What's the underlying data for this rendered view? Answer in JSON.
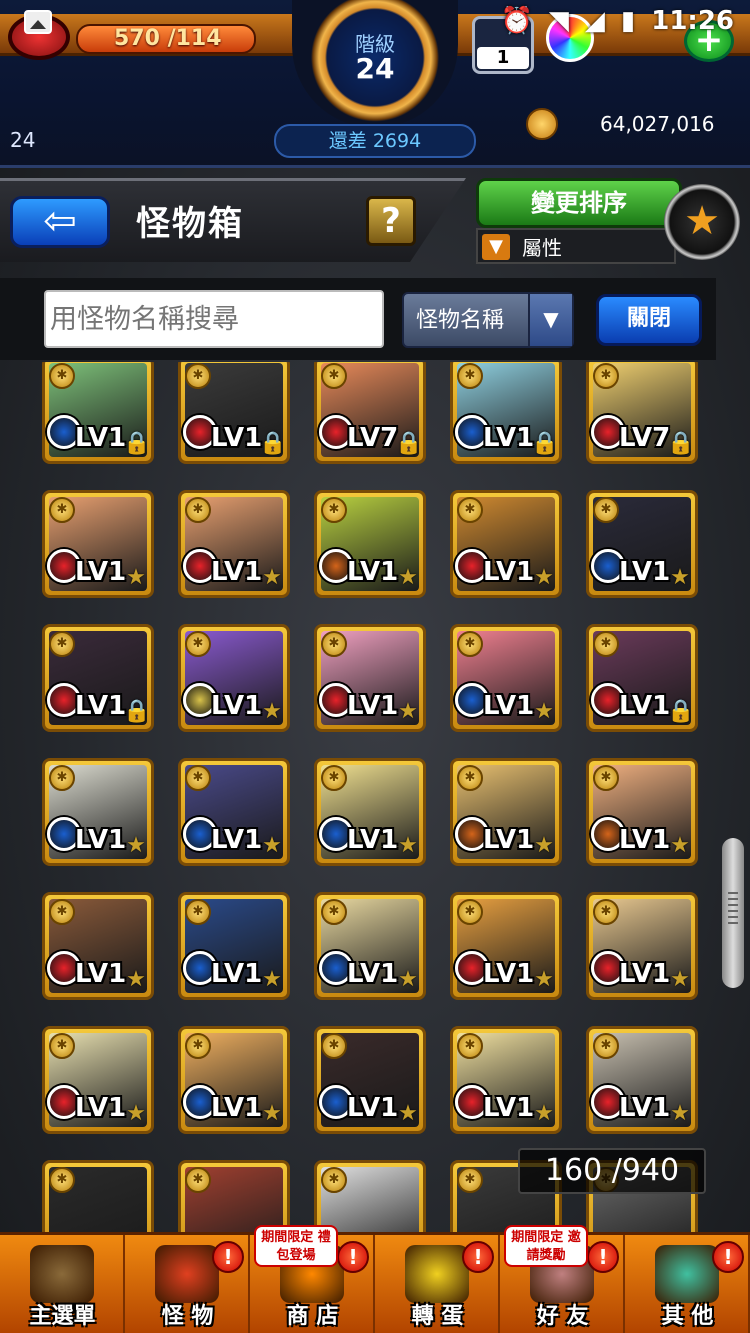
{
  "status_bar": {
    "time": "11:26"
  },
  "hud": {
    "stamina": "570 /114",
    "rank_label": "階級",
    "rank_value": "24",
    "exp_remaining": "還差 2694",
    "left_number": "24",
    "gem_count": "1",
    "coins": "64,027,016",
    "plus": "+"
  },
  "header": {
    "back_arrow": "⇦",
    "title": "怪物箱",
    "help": "?",
    "sort_button": "變更排序",
    "filter_label": "屬性",
    "filter_icon": "filter-icon",
    "star_icon": "★"
  },
  "search": {
    "placeholder": "用怪物名稱搜尋",
    "select_value": "怪物名稱",
    "select_arrow": "▼",
    "close_button": "關閉"
  },
  "grid": {
    "counter": "160 /940",
    "cards": [
      {
        "lv": "LV1",
        "attr": "water",
        "mark": "lock"
      },
      {
        "lv": "LV1",
        "attr": "fire",
        "mark": "lock"
      },
      {
        "lv": "LV7",
        "attr": "fire",
        "mark": "lock"
      },
      {
        "lv": "LV1",
        "attr": "water",
        "mark": "lock"
      },
      {
        "lv": "LV7",
        "attr": "fire",
        "mark": "lock"
      },
      {
        "lv": "LV1",
        "attr": "fire",
        "mark": "star"
      },
      {
        "lv": "LV1",
        "attr": "fire",
        "mark": "star"
      },
      {
        "lv": "LV1",
        "attr": "wood",
        "mark": "star"
      },
      {
        "lv": "LV1",
        "attr": "fire",
        "mark": "star"
      },
      {
        "lv": "LV1",
        "attr": "water",
        "mark": "star"
      },
      {
        "lv": "LV1",
        "attr": "fire",
        "mark": "lock"
      },
      {
        "lv": "LV1",
        "attr": "light",
        "mark": "star"
      },
      {
        "lv": "LV1",
        "attr": "fire",
        "mark": "star"
      },
      {
        "lv": "LV1",
        "attr": "water",
        "mark": "star"
      },
      {
        "lv": "LV1",
        "attr": "fire",
        "mark": "lock"
      },
      {
        "lv": "LV1",
        "attr": "water",
        "mark": "star"
      },
      {
        "lv": "LV1",
        "attr": "water",
        "mark": "star"
      },
      {
        "lv": "LV1",
        "attr": "water",
        "mark": "star"
      },
      {
        "lv": "LV1",
        "attr": "wood",
        "mark": "star"
      },
      {
        "lv": "LV1",
        "attr": "wood",
        "mark": "star"
      },
      {
        "lv": "LV1",
        "attr": "fire",
        "mark": "star"
      },
      {
        "lv": "LV1",
        "attr": "water",
        "mark": "star"
      },
      {
        "lv": "LV1",
        "attr": "water",
        "mark": "star"
      },
      {
        "lv": "LV1",
        "attr": "fire",
        "mark": "star"
      },
      {
        "lv": "LV1",
        "attr": "fire",
        "mark": "star"
      },
      {
        "lv": "LV1",
        "attr": "fire",
        "mark": "star"
      },
      {
        "lv": "LV1",
        "attr": "water",
        "mark": "star"
      },
      {
        "lv": "LV1",
        "attr": "water",
        "mark": "star"
      },
      {
        "lv": "LV1",
        "attr": "fire",
        "mark": "star"
      },
      {
        "lv": "LV1",
        "attr": "fire",
        "mark": "star"
      },
      {
        "lv": "",
        "attr": "",
        "mark": ""
      },
      {
        "lv": "",
        "attr": "",
        "mark": ""
      },
      {
        "lv": "",
        "attr": "",
        "mark": ""
      },
      {
        "lv": "",
        "attr": "",
        "mark": ""
      },
      {
        "lv": "",
        "attr": "",
        "mark": ""
      }
    ]
  },
  "nav": {
    "items": [
      {
        "label": "主選單",
        "alert": ""
      },
      {
        "label": "怪 物",
        "alert": "!"
      },
      {
        "label": "商 店",
        "alert": "!",
        "promo": "期間限定 禮包登場"
      },
      {
        "label": "轉 蛋",
        "alert": "!"
      },
      {
        "label": "好 友",
        "alert": "!",
        "promo": "期間限定 邀請獎勵"
      },
      {
        "label": "其 他",
        "alert": "!"
      }
    ]
  },
  "colors": {
    "fire": "#e8222a",
    "water": "#1a5fcf",
    "wood": "#d4641a",
    "light": "#d8c24a"
  }
}
